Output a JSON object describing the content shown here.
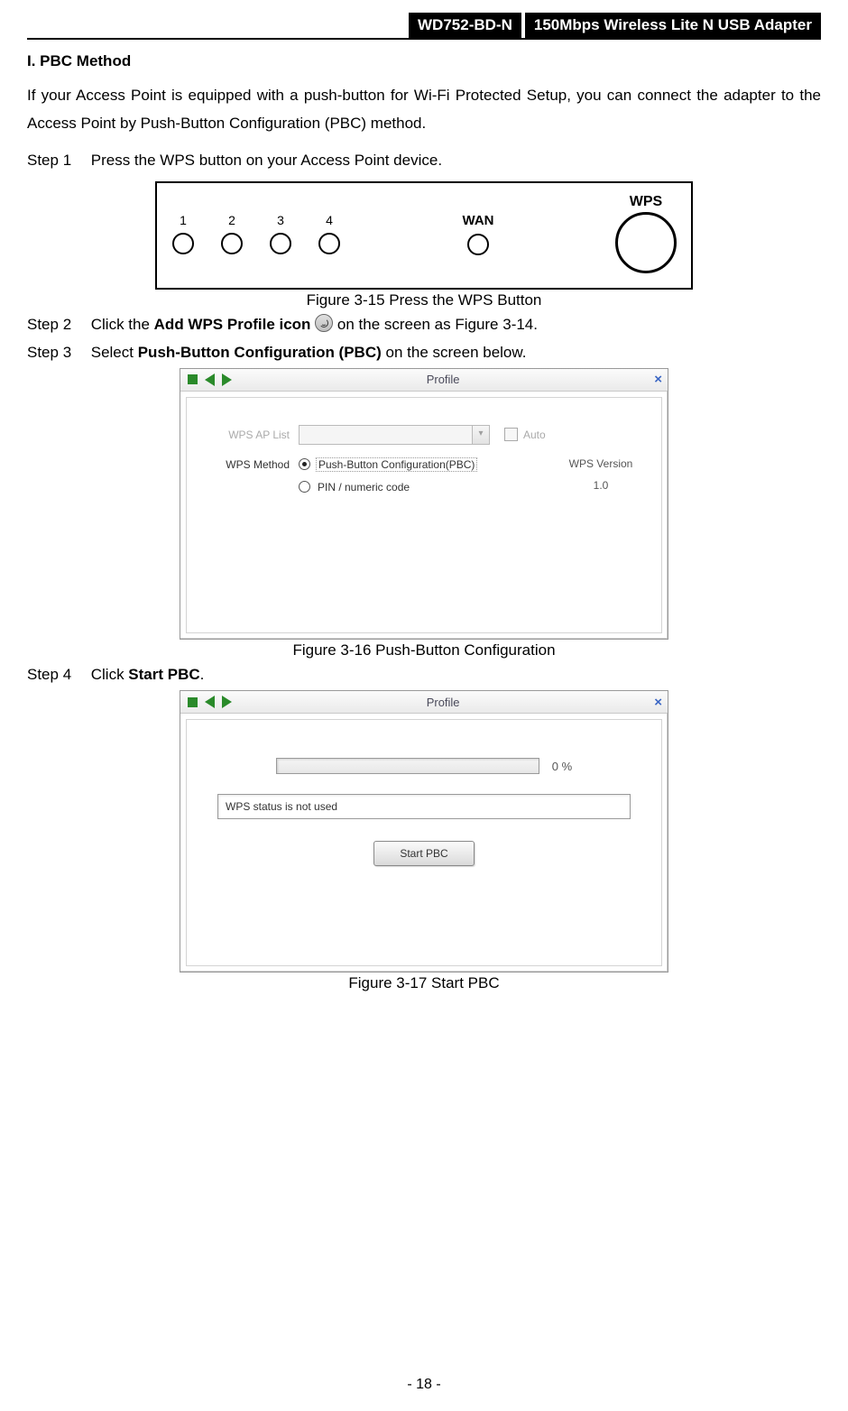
{
  "header": {
    "model": "WD752-BD-N",
    "desc": "150Mbps Wireless Lite N USB Adapter"
  },
  "section": {
    "title": "I.    PBC Method"
  },
  "intro": "If your Access Point is equipped with a push-button for Wi-Fi Protected Setup, you can connect the adapter to the Access Point by Push-Button Configuration (PBC) method.",
  "steps": {
    "s1_label": "Step 1",
    "s1_text": "Press the WPS button on your Access Point device.",
    "s2_label": "Step 2",
    "s2_a": "Click the ",
    "s2_bold": "Add WPS Profile icon",
    "s2_b": " on the screen as Figure 3-14.",
    "s3_label": "Step 3",
    "s3_a": "Select ",
    "s3_bold": "Push-Button Configuration (PBC)",
    "s3_b": " on the screen below.",
    "s4_label": "Step 4",
    "s4_a": "Click ",
    "s4_bold": "Start PBC",
    "s4_b": "."
  },
  "fig15": {
    "caption": "Figure 3-15 Press the WPS Button",
    "ports": [
      "1",
      "2",
      "3",
      "4"
    ],
    "wan": "WAN",
    "wps": "WPS"
  },
  "fig16": {
    "caption": "Figure 3-16 Push-Button Configuration",
    "title": "Profile",
    "wps_ap_list": "WPS AP List",
    "auto": "Auto",
    "wps_method": "WPS Method",
    "opt_pbc": "Push-Button Configuration(PBC)",
    "opt_pin": "PIN / numeric code",
    "wps_version_lbl": "WPS Version",
    "wps_version_val": "1.0"
  },
  "fig17": {
    "caption": "Figure 3-17 Start PBC",
    "title": "Profile",
    "percent": "0 %",
    "status": "WPS status is not used",
    "button": "Start PBC"
  },
  "page_number": "- 18 -"
}
